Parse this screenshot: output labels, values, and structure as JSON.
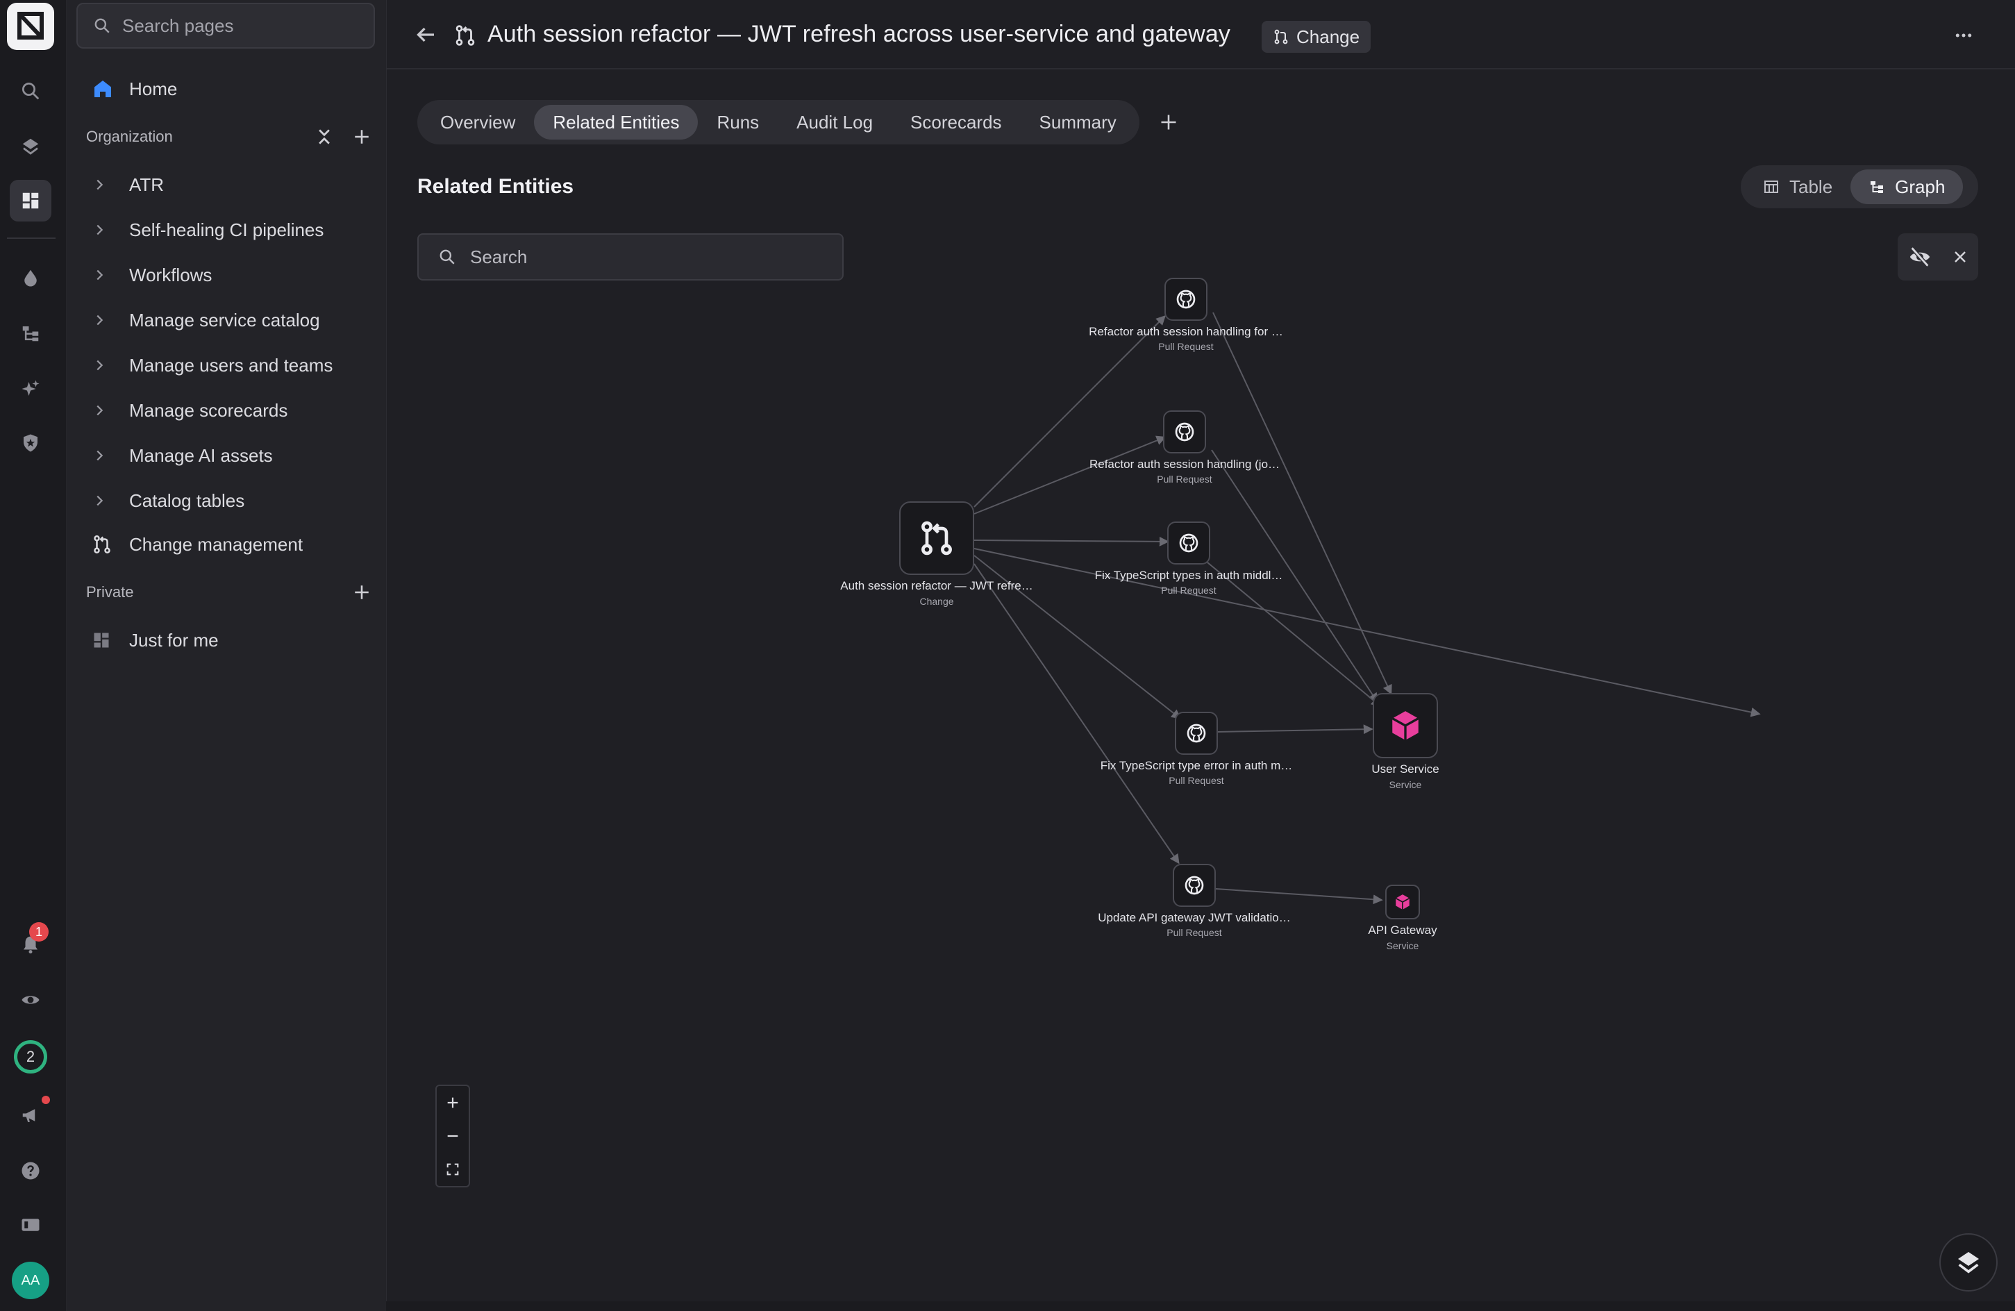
{
  "sidebar": {
    "search_placeholder": "Search pages",
    "home_label": "Home",
    "org_section_label": "Organization",
    "org_items": [
      {
        "label": "ATR"
      },
      {
        "label": "Self-healing CI pipelines"
      },
      {
        "label": "Workflows"
      },
      {
        "label": "Manage service catalog"
      },
      {
        "label": "Manage users and teams"
      },
      {
        "label": "Manage scorecards"
      },
      {
        "label": "Manage AI assets"
      },
      {
        "label": "Catalog tables"
      }
    ],
    "change_mgmt_label": "Change management",
    "private_section_label": "Private",
    "private_items": [
      {
        "label": "Just for me"
      }
    ]
  },
  "rail": {
    "notification_count": "1",
    "progress_count": "2",
    "avatar_initials": "AA"
  },
  "header": {
    "title": "Auth session refactor — JWT refresh across user-service and gateway",
    "kind_chip": "Change"
  },
  "tabs": [
    {
      "label": "Overview",
      "active": false
    },
    {
      "label": "Related Entities",
      "active": true
    },
    {
      "label": "Runs",
      "active": false
    },
    {
      "label": "Audit Log",
      "active": false
    },
    {
      "label": "Scorecards",
      "active": false
    },
    {
      "label": "Summary",
      "active": false
    }
  ],
  "section_title": "Related Entities",
  "view_toggle": {
    "table_label": "Table",
    "graph_label": "Graph",
    "selected": "Graph"
  },
  "graph_search_placeholder": "Search",
  "graph": {
    "nodes": {
      "change": {
        "label": "Auth session refactor — JWT refre…",
        "kind": "Change"
      },
      "pr1": {
        "label": "Refactor auth session handling for …",
        "kind": "Pull Request"
      },
      "pr2": {
        "label": "Refactor auth session handling (jo…",
        "kind": "Pull Request"
      },
      "pr3": {
        "label": "Fix TypeScript types in auth middl…",
        "kind": "Pull Request"
      },
      "pr4": {
        "label": "Fix TypeScript type error in auth m…",
        "kind": "Pull Request"
      },
      "pr5": {
        "label": "Update API gateway JWT validatio…",
        "kind": "Pull Request"
      },
      "svc_user": {
        "label": "User Service",
        "kind": "Service"
      },
      "svc_gateway": {
        "label": "API Gateway",
        "kind": "Service"
      }
    },
    "colors": {
      "edge": "#5a5a62",
      "service": "#e83e9c"
    }
  }
}
